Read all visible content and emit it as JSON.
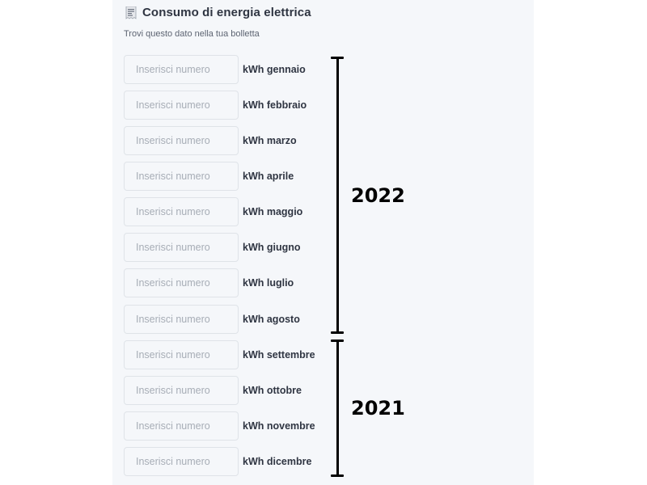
{
  "header": {
    "icon": "bill-icon",
    "title": "Consumo di energia elettrica",
    "subtitle": "Trovi questo dato nella tua bolletta"
  },
  "inputs": {
    "placeholder": "Inserisci numero",
    "rows": [
      {
        "label": "kWh gennaio",
        "value": ""
      },
      {
        "label": "kWh febbraio",
        "value": ""
      },
      {
        "label": "kWh marzo",
        "value": ""
      },
      {
        "label": "kWh aprile",
        "value": ""
      },
      {
        "label": "kWh maggio",
        "value": ""
      },
      {
        "label": "kWh giugno",
        "value": ""
      },
      {
        "label": "kWh luglio",
        "value": ""
      },
      {
        "label": "kWh agosto",
        "value": ""
      },
      {
        "label": "kWh settembre",
        "value": ""
      },
      {
        "label": "kWh ottobre",
        "value": ""
      },
      {
        "label": "kWh novembre",
        "value": ""
      },
      {
        "label": "kWh dicembre",
        "value": ""
      }
    ]
  },
  "annotations": {
    "year_upper": "2022",
    "year_lower": "2021"
  },
  "colors": {
    "panel_background": "#f5f7fa",
    "text_dark": "#2f3542",
    "placeholder": "#a7adb6",
    "annotation": "#000000"
  }
}
